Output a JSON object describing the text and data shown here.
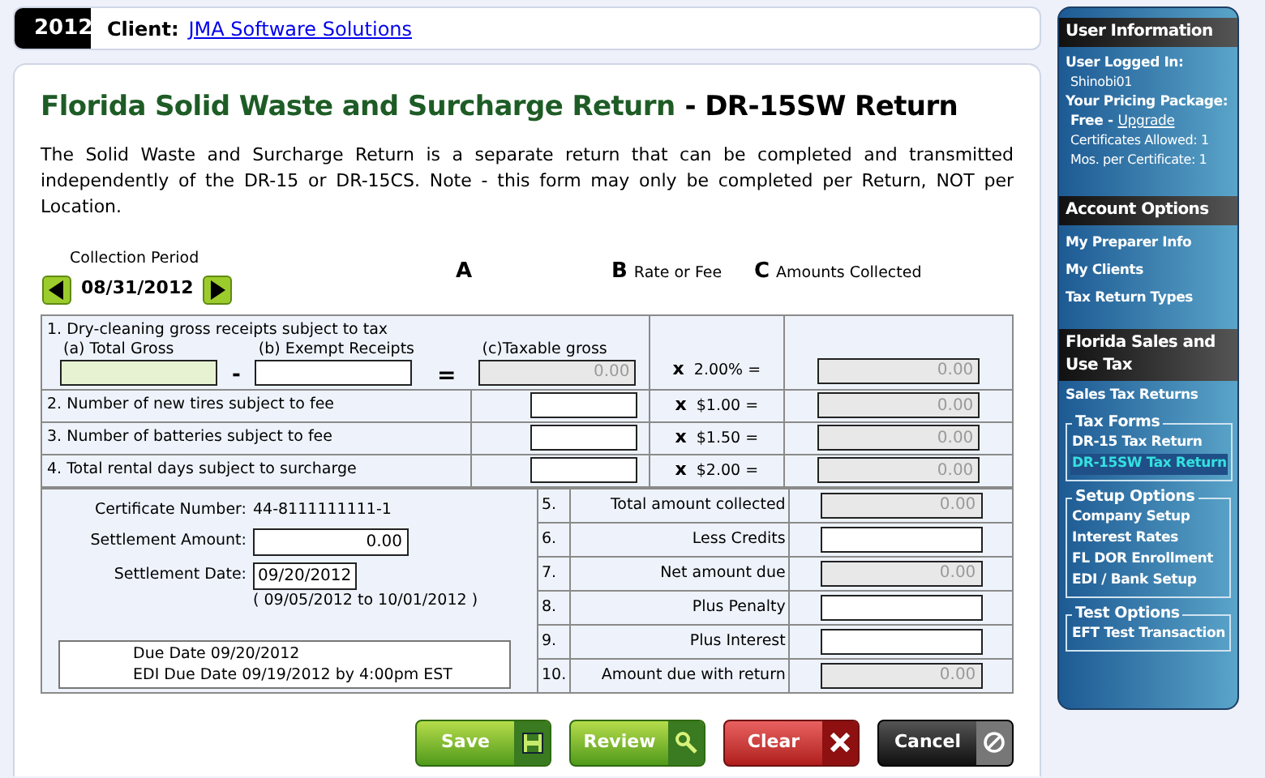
{
  "header": {
    "year": "2012",
    "client_label": "Client:",
    "client_name": "JMA Software Solutions"
  },
  "title": {
    "main": "Florida Solid Waste and Surcharge Return",
    "sub": "- DR-15SW Return"
  },
  "description": "The Solid Waste and Surcharge Return is a separate return that can be completed and transmitted independently of the DR-15 or DR-15CS. Note - this form may only be completed per Return, NOT per Location.",
  "collection_period": {
    "label": "Collection Period",
    "date": "08/31/2012"
  },
  "column_headers": [
    {
      "letter": "A"
    },
    {
      "letter": "B",
      "label": "Rate or Fee"
    },
    {
      "letter": "C",
      "label": "Amounts Collected"
    }
  ],
  "row_1": {
    "label": "1. Dry-cleaning gross receipts subject to tax",
    "total_gross": {
      "label": "(a) Total Gross",
      "highlighted": true,
      "readonly": false
    },
    "minus": "-",
    "exempt": {
      "label": "(b) Exempt Receipts",
      "highlighted": false,
      "readonly": false
    },
    "equals": "=",
    "taxable": {
      "label": "(c)Taxable gross",
      "value": "0.00",
      "readonly": true
    },
    "times": "x",
    "rate": "2.00% =",
    "amount": {
      "value": "0.00",
      "readonly": true
    }
  },
  "fee_rows": [
    {
      "label": "2. Number of new tires subject to fee",
      "field": {
        "readonly": false
      },
      "times": "x",
      "rate": "$1.00 =",
      "amount": {
        "value": "0.00",
        "readonly": true
      }
    },
    {
      "label": "3. Number of batteries subject to fee",
      "field": {
        "readonly": false
      },
      "times": "x",
      "rate": "$1.50 =",
      "amount": {
        "value": "0.00",
        "readonly": true
      }
    },
    {
      "label": "4. Total rental days subject to surcharge",
      "field": {
        "readonly": false
      },
      "times": "x",
      "rate": "$2.00 =",
      "amount": {
        "value": "0.00",
        "readonly": true
      }
    }
  ],
  "certificate": {
    "label": "Certificate Number:",
    "value": "44-8111111111-1"
  },
  "settlement_amount": {
    "label": "Settlement Amount:",
    "value": "0.00"
  },
  "settlement_date": {
    "label": "Settlement Date:",
    "value": "09/20/2012",
    "range": "( 09/05/2012 to 10/01/2012 )"
  },
  "due_dates": [
    "Due Date 09/20/2012",
    "EDI Due Date 09/19/2012 by 4:00pm EST"
  ],
  "summary_lines": [
    {
      "number": "5.",
      "label": "Total amount collected",
      "field": {
        "value": "0.00",
        "readonly": true
      }
    },
    {
      "number": "6.",
      "label": "Less Credits",
      "field": {
        "readonly": false
      }
    },
    {
      "number": "7.",
      "label": "Net amount due",
      "field": {
        "value": "0.00",
        "readonly": true
      }
    },
    {
      "number": "8.",
      "label": "Plus Penalty",
      "field": {
        "readonly": false
      }
    },
    {
      "number": "9.",
      "label": "Plus Interest",
      "field": {
        "readonly": false
      }
    },
    {
      "number": "10.",
      "label": "Amount due with return",
      "field": {
        "value": "0.00",
        "readonly": true
      }
    }
  ],
  "buttons": [
    {
      "label": "Save",
      "kind": "save"
    },
    {
      "label": "Review",
      "kind": "review"
    },
    {
      "label": "Clear",
      "kind": "clear"
    },
    {
      "label": "Cancel",
      "kind": "cancel"
    }
  ],
  "sidebar": {
    "user_info": {
      "title": "User Information",
      "logged_in_label": "User Logged In:",
      "username": "Shinobi01",
      "package_label": "Your Pricing Package:",
      "package": "Free -",
      "upgrade": "Upgrade",
      "details": [
        "Certificates Allowed: 1",
        "Mos. per Certificate: 1"
      ]
    },
    "account_options": {
      "title": "Account Options",
      "items": [
        "My Preparer Info",
        "My Clients",
        "Tax Return Types"
      ]
    },
    "florida": {
      "title": "Florida Sales and Use Tax",
      "items": [
        "Sales Tax Returns"
      ],
      "groups": [
        {
          "legend": "Tax Forms",
          "items": [
            {
              "label": "DR-15 Tax Return",
              "selected": false
            },
            {
              "label": "DR-15SW Tax Return",
              "selected": true
            }
          ]
        },
        {
          "legend": "Setup Options",
          "items": [
            {
              "label": "Company Setup",
              "selected": false
            },
            {
              "label": "Interest Rates",
              "selected": false
            },
            {
              "label": "FL DOR Enrollment",
              "selected": false
            },
            {
              "label": "EDI / Bank Setup",
              "selected": false
            }
          ]
        },
        {
          "legend": "Test Options",
          "items": [
            {
              "label": "EFT Test Transaction",
              "selected": false
            }
          ]
        }
      ]
    }
  }
}
